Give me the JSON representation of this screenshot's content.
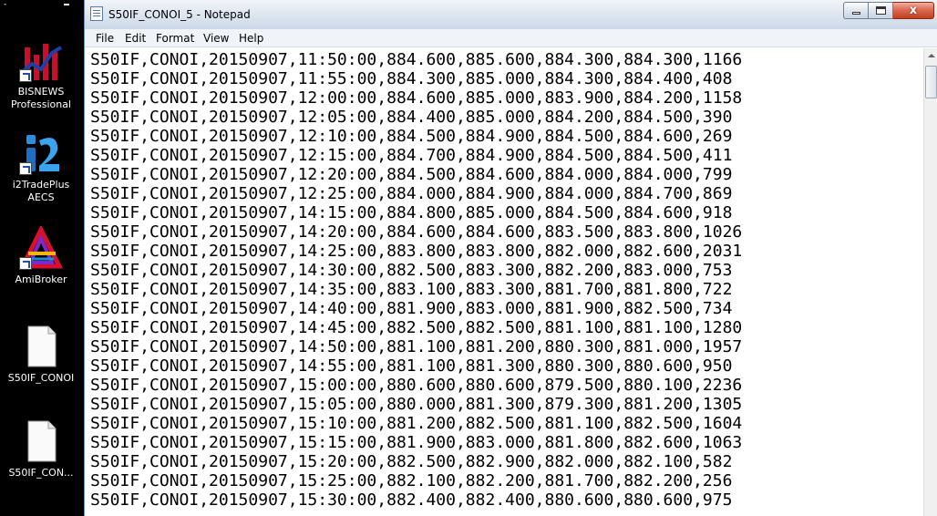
{
  "desktop": {
    "icons": [
      {
        "label_line1": "BISNEWS",
        "label_line2": "Professional",
        "icon": "bisnews-chart-icon"
      },
      {
        "label_line1": "i2TradePlus",
        "label_line2": "AECS",
        "icon": "i2tradeplus-icon"
      },
      {
        "label_line1": "AmiBroker",
        "label_line2": "",
        "icon": "amibroker-icon"
      },
      {
        "label_line1": "S50IF_CONOI",
        "label_line2": "",
        "icon": "text-file-icon"
      },
      {
        "label_line1": "S50IF_CON...",
        "label_line2": "",
        "icon": "text-file-icon"
      }
    ]
  },
  "window": {
    "title": "S50IF_CONOI_5 - Notepad",
    "menu": [
      "File",
      "Edit",
      "Format",
      "View",
      "Help"
    ],
    "controls": {
      "minimize": "minimize",
      "maximize": "maximize",
      "close": "x"
    }
  },
  "document": {
    "lines": [
      "S50IF,CONOI,20150907,11:50:00,884.600,885.600,884.300,884.300,1166",
      "S50IF,CONOI,20150907,11:55:00,884.300,885.000,884.300,884.400,408",
      "S50IF,CONOI,20150907,12:00:00,884.600,885.000,883.900,884.200,1158",
      "S50IF,CONOI,20150907,12:05:00,884.400,885.000,884.200,884.500,390",
      "S50IF,CONOI,20150907,12:10:00,884.500,884.900,884.500,884.600,269",
      "S50IF,CONOI,20150907,12:15:00,884.700,884.900,884.500,884.500,411",
      "S50IF,CONOI,20150907,12:20:00,884.500,884.600,884.000,884.000,799",
      "S50IF,CONOI,20150907,12:25:00,884.000,884.900,884.000,884.700,869",
      "S50IF,CONOI,20150907,14:15:00,884.800,885.000,884.500,884.600,918",
      "S50IF,CONOI,20150907,14:20:00,884.600,884.600,883.500,883.800,1026",
      "S50IF,CONOI,20150907,14:25:00,883.800,883.800,882.000,882.600,2031",
      "S50IF,CONOI,20150907,14:30:00,882.500,883.300,882.200,883.000,753",
      "S50IF,CONOI,20150907,14:35:00,883.100,883.300,881.700,881.800,722",
      "S50IF,CONOI,20150907,14:40:00,881.900,883.000,881.900,882.500,734",
      "S50IF,CONOI,20150907,14:45:00,882.500,882.500,881.100,881.100,1280",
      "S50IF,CONOI,20150907,14:50:00,881.100,881.200,880.300,881.000,1957",
      "S50IF,CONOI,20150907,14:55:00,881.100,881.300,880.300,880.600,950",
      "S50IF,CONOI,20150907,15:00:00,880.600,880.600,879.500,880.100,2236",
      "S50IF,CONOI,20150907,15:05:00,880.000,881.300,879.300,881.200,1305",
      "S50IF,CONOI,20150907,15:10:00,881.200,882.500,881.100,882.500,1604",
      "S50IF,CONOI,20150907,15:15:00,881.900,883.000,881.800,882.600,1063",
      "S50IF,CONOI,20150907,15:20:00,882.500,882.900,882.000,882.100,582",
      "S50IF,CONOI,20150907,15:25:00,882.100,882.200,881.700,882.200,256",
      "S50IF,CONOI,20150907,15:30:00,882.400,882.400,880.600,880.600,975"
    ]
  }
}
